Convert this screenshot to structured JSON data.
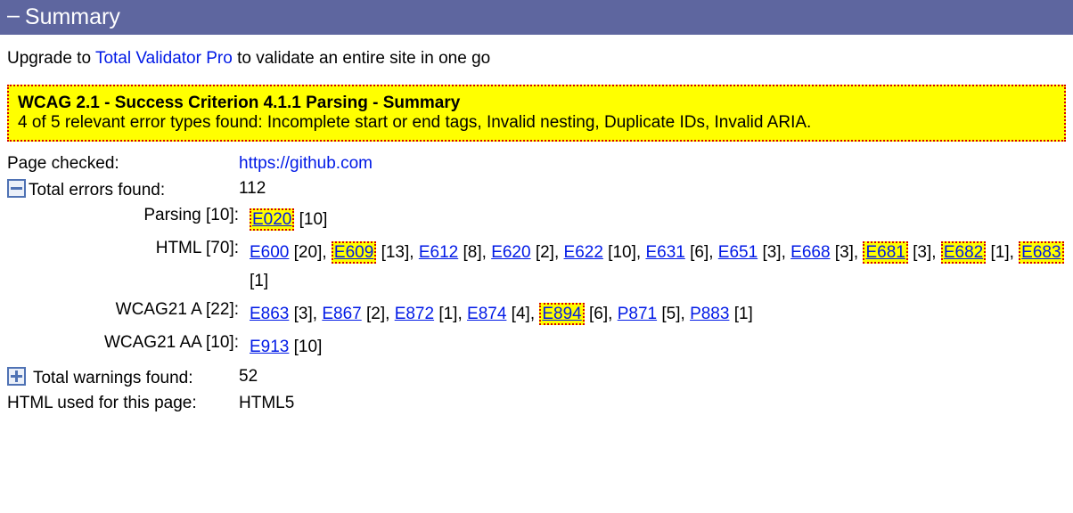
{
  "header": {
    "title": "Summary"
  },
  "upgrade": {
    "prefix": "Upgrade to ",
    "link_text": "Total Validator Pro",
    "suffix": " to validate an entire site in one go"
  },
  "wcag_box": {
    "title": "WCAG 2.1 - Success Criterion 4.1.1 Parsing - Summary",
    "body": "4 of 5 relevant error types found: Incomplete start or end tags, Invalid nesting, Duplicate IDs, Invalid ARIA."
  },
  "page_checked": {
    "label": "Page checked:",
    "url": "https://github.com"
  },
  "total_errors": {
    "label": "Total errors found:",
    "value": "112"
  },
  "groups": [
    {
      "label": "Parsing [10]:",
      "codes": [
        {
          "code": "E020",
          "count": 10,
          "highlight": true
        }
      ]
    },
    {
      "label": "HTML [70]:",
      "codes": [
        {
          "code": "E600",
          "count": 20,
          "highlight": false
        },
        {
          "code": "E609",
          "count": 13,
          "highlight": true
        },
        {
          "code": "E612",
          "count": 8,
          "highlight": false
        },
        {
          "code": "E620",
          "count": 2,
          "highlight": false
        },
        {
          "code": "E622",
          "count": 10,
          "highlight": false
        },
        {
          "code": "E631",
          "count": 6,
          "highlight": false
        },
        {
          "code": "E651",
          "count": 3,
          "highlight": false
        },
        {
          "code": "E668",
          "count": 3,
          "highlight": false
        },
        {
          "code": "E681",
          "count": 3,
          "highlight": true
        },
        {
          "code": "E682",
          "count": 1,
          "highlight": true
        },
        {
          "code": "E683",
          "count": 1,
          "highlight": true
        }
      ]
    },
    {
      "label": "WCAG21 A [22]:",
      "codes": [
        {
          "code": "E863",
          "count": 3,
          "highlight": false
        },
        {
          "code": "E867",
          "count": 2,
          "highlight": false
        },
        {
          "code": "E872",
          "count": 1,
          "highlight": false
        },
        {
          "code": "E874",
          "count": 4,
          "highlight": false
        },
        {
          "code": "E894",
          "count": 6,
          "highlight": true
        },
        {
          "code": "P871",
          "count": 5,
          "highlight": false
        },
        {
          "code": "P883",
          "count": 1,
          "highlight": false
        }
      ]
    },
    {
      "label": "WCAG21 AA [10]:",
      "codes": [
        {
          "code": "E913",
          "count": 10,
          "highlight": false
        }
      ]
    }
  ],
  "total_warnings": {
    "label": "Total warnings found:",
    "value": "52"
  },
  "html_used": {
    "label": "HTML used for this page:",
    "value": "HTML5"
  }
}
